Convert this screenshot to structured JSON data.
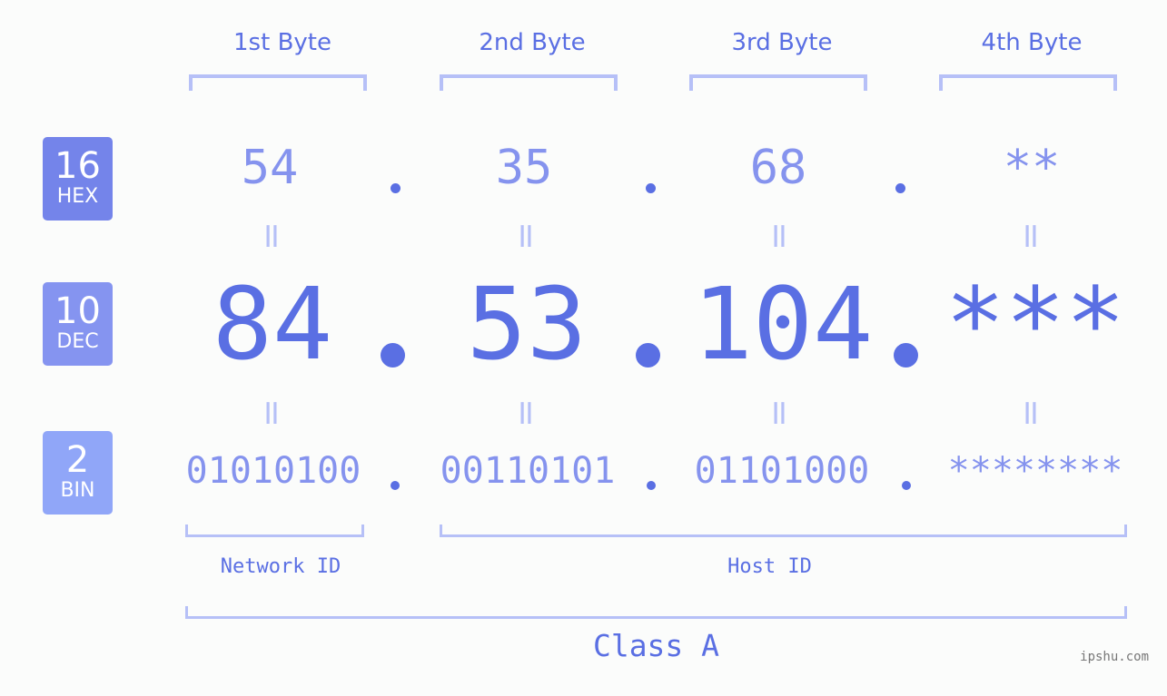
{
  "badges": [
    {
      "num": "16",
      "label": "HEX",
      "color": "#7484ea"
    },
    {
      "num": "10",
      "label": "DEC",
      "color": "#8594f0"
    },
    {
      "num": "2",
      "label": "BIN",
      "color": "#90a6f8"
    }
  ],
  "bytes": [
    {
      "header": "1st Byte",
      "hex": "54",
      "dec": "84",
      "bin": "01010100"
    },
    {
      "header": "2nd Byte",
      "hex": "35",
      "dec": "53",
      "bin": "00110101"
    },
    {
      "header": "3rd Byte",
      "hex": "68",
      "dec": "104",
      "bin": "01101000"
    },
    {
      "header": "4th Byte",
      "hex": "**",
      "dec": "***",
      "bin": "********"
    }
  ],
  "equals_symbol": "=",
  "separator": ".",
  "segments": {
    "network_id": "Network ID",
    "host_id": "Host ID",
    "class": "Class A"
  },
  "watermark": "ipshu.com",
  "colors": {
    "primary": "#5a6fe3",
    "secondary": "#8593ee",
    "bracket": "#b6c0f7",
    "background": "#fbfcfb"
  }
}
